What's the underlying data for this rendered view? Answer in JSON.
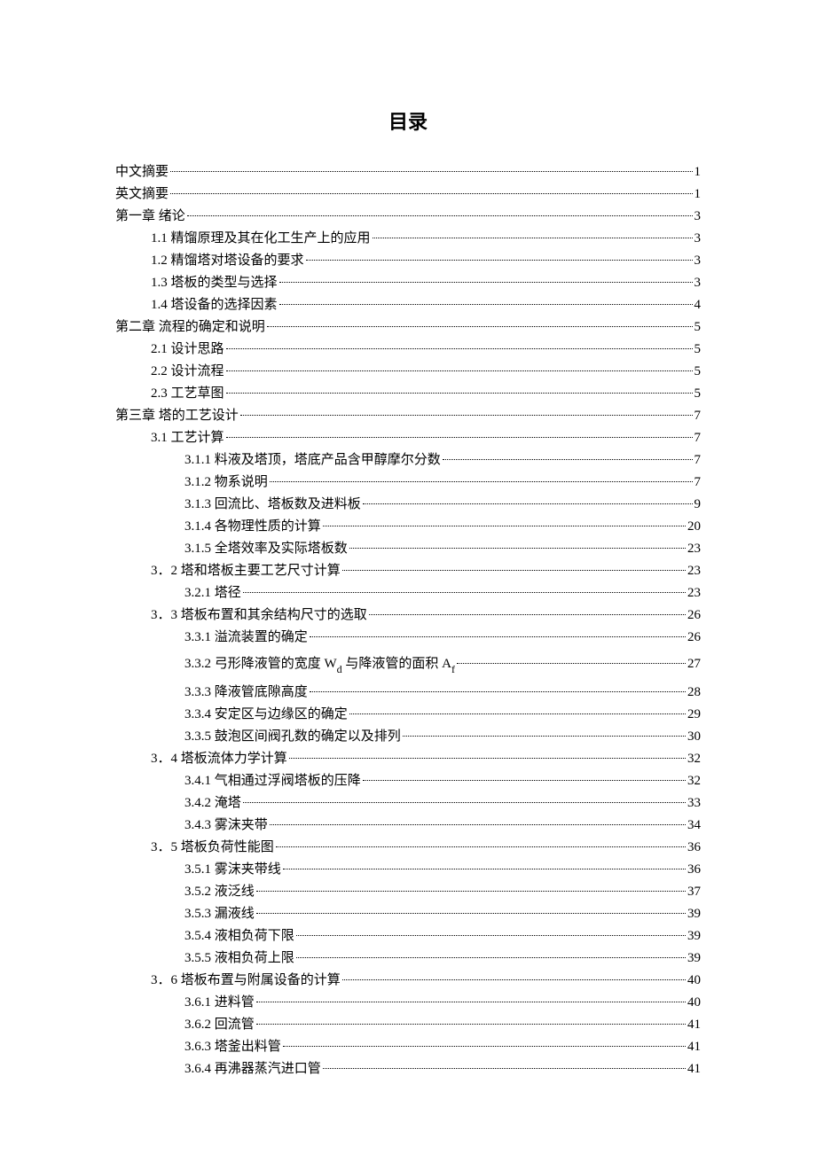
{
  "title": "目录",
  "entries": [
    {
      "level": 0,
      "label": "中文摘要",
      "page": "1"
    },
    {
      "level": 0,
      "label": "英文摘要",
      "page": "1"
    },
    {
      "level": 0,
      "label": "第一章  绪论",
      "page": "3"
    },
    {
      "level": 1,
      "label": "1.1 精馏原理及其在化工生产上的应用",
      "page": "3"
    },
    {
      "level": 1,
      "label": "1.2 精馏塔对塔设备的要求",
      "page": "3"
    },
    {
      "level": 1,
      "label": "1.3 塔板的类型与选择",
      "page": "3"
    },
    {
      "level": 1,
      "label": "1.4 塔设备的选择因素",
      "page": "4"
    },
    {
      "level": 0,
      "label": "第二章  流程的确定和说明",
      "page": "5"
    },
    {
      "level": 1,
      "label": "2.1 设计思路",
      "page": "5"
    },
    {
      "level": 1,
      "label": "2.2 设计流程",
      "page": "5"
    },
    {
      "level": 1,
      "label": "2.3 工艺草图",
      "page": "5"
    },
    {
      "level": 0,
      "label": "第三章  塔的工艺设计",
      "page": "7"
    },
    {
      "level": 1,
      "label": "3.1 工艺计算",
      "page": "7"
    },
    {
      "level": 2,
      "label": "3.1.1 料液及塔顶，塔底产品含甲醇摩尔分数",
      "page": "7"
    },
    {
      "level": 2,
      "label": "3.1.2  物系说明",
      "page": "7"
    },
    {
      "level": 2,
      "label": "3.1.3  回流比、塔板数及进料板",
      "page": "9"
    },
    {
      "level": 2,
      "label": "3.1.4  各物理性质的计算",
      "page": "20"
    },
    {
      "level": 2,
      "label": "3.1.5 全塔效率及实际塔板数",
      "page": "23"
    },
    {
      "level": 1,
      "label": "3．2 塔和塔板主要工艺尺寸计算",
      "page": "23"
    },
    {
      "level": 2,
      "label": "3.2.1 塔径",
      "page": "23"
    },
    {
      "level": 1,
      "label": "3．3 塔板布置和其余结构尺寸的选取",
      "page": "26"
    },
    {
      "level": 2,
      "label": "3.3.1  溢流装置的确定",
      "page": "26"
    },
    {
      "level": 2,
      "label": "3.3.2  弓形降液管的宽度 W_d 与降液管的面积 A_f",
      "page": "27",
      "special": true
    },
    {
      "level": 2,
      "label": "3.3.3 降液管底隙高度",
      "page": "28"
    },
    {
      "level": 2,
      "label": "3.3.4  安定区与边缘区的确定",
      "page": "29"
    },
    {
      "level": 2,
      "label": "3.3.5 鼓泡区间阀孔数的确定以及排列",
      "page": "30"
    },
    {
      "level": 1,
      "label": "3．4 塔板流体力学计算",
      "page": "32"
    },
    {
      "level": 2,
      "label": "3.4.1  气相通过浮阀塔板的压降",
      "page": "32"
    },
    {
      "level": 2,
      "label": "3.4.2  淹塔",
      "page": "33"
    },
    {
      "level": 2,
      "label": "3.4.3  雾沫夹带",
      "page": "34"
    },
    {
      "level": 1,
      "label": "3．5  塔板负荷性能图",
      "page": "36"
    },
    {
      "level": 2,
      "label": "3.5.1 雾沫夹带线",
      "page": "36"
    },
    {
      "level": 2,
      "label": "3.5.2 液泛线",
      "page": "37"
    },
    {
      "level": 2,
      "label": "3.5.3  漏液线",
      "page": "39"
    },
    {
      "level": 2,
      "label": "3.5.4 液相负荷下限",
      "page": "39"
    },
    {
      "level": 2,
      "label": "3.5.5 液相负荷上限",
      "page": "39"
    },
    {
      "level": 1,
      "label": "3．6 塔板布置与附属设备的计算",
      "page": "40"
    },
    {
      "level": 2,
      "label": "3.6.1 进料管",
      "page": "40"
    },
    {
      "level": 2,
      "label": "3.6.2 回流管",
      "page": "41"
    },
    {
      "level": 2,
      "label": "3.6.3 塔釜出料管",
      "page": "41"
    },
    {
      "level": 2,
      "label": "3.6.4 再沸器蒸汽进口管",
      "page": "41"
    }
  ],
  "special_332_prefix": "3.3.2  弓形降液管的宽度 W",
  "special_332_sub1": "d",
  "special_332_mid": " 与降液管的面积 A",
  "special_332_sub2": "f",
  "special_332_suffix": " "
}
